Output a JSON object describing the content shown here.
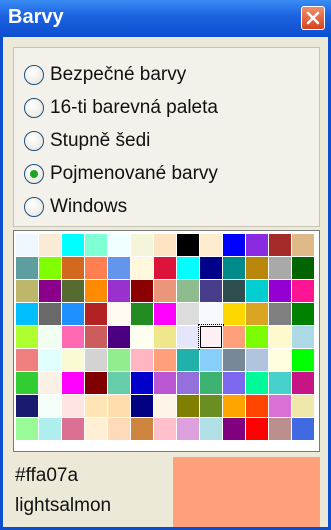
{
  "window": {
    "title": "Barvy",
    "close_icon": "close-icon"
  },
  "options": [
    {
      "label": "Bezpečné barvy",
      "checked": false
    },
    {
      "label": "16-ti barevná paleta",
      "checked": false
    },
    {
      "label": "Stupně šedi",
      "checked": false
    },
    {
      "label": "Pojmenované barvy",
      "checked": true
    },
    {
      "label": "Windows",
      "checked": false
    }
  ],
  "palette": {
    "selected_index": 60,
    "colors": [
      "#f0f8ff",
      "#faebd7",
      "#00ffff",
      "#7fffd4",
      "#f0ffff",
      "#f5f5dc",
      "#ffe4c4",
      "#000000",
      "#ffebcd",
      "#0000ff",
      "#8a2be2",
      "#a52a2a",
      "#deb887",
      "#5f9ea0",
      "#7fff00",
      "#d2691e",
      "#ff7f50",
      "#6495ed",
      "#fff8dc",
      "#dc143c",
      "#00ffff",
      "#00008b",
      "#008b8b",
      "#b8860b",
      "#a9a9a9",
      "#006400",
      "#bdb76b",
      "#8b008b",
      "#556b2f",
      "#ff8c00",
      "#9932cc",
      "#8b0000",
      "#e9967a",
      "#8fbc8f",
      "#483d8b",
      "#2f4f4f",
      "#00ced1",
      "#9400d3",
      "#ff1493",
      "#00bfff",
      "#696969",
      "#1e90ff",
      "#b22222",
      "#fffaf0",
      "#228b22",
      "#ff00ff",
      "#dcdcdc",
      "#f8f8ff",
      "#ffd700",
      "#daa520",
      "#808080",
      "#008000",
      "#adff2f",
      "#f0fff0",
      "#ff69b4",
      "#cd5c5c",
      "#4b0082",
      "#fffff0",
      "#f0e68c",
      "#e6e6fa",
      "#fff0f5",
      "#ffa07a",
      "#7cfc00",
      "#fffacd",
      "#add8e6",
      "#f08080",
      "#e0ffff",
      "#fafad2",
      "#d3d3d3",
      "#90ee90",
      "#ffb6c1",
      "#ffa07a",
      "#20b2aa",
      "#87cefa",
      "#778899",
      "#b0c4de",
      "#ffffe0",
      "#00ff00",
      "#32cd32",
      "#faf0e6",
      "#ff00ff",
      "#800000",
      "#66cdaa",
      "#0000cd",
      "#ba55d3",
      "#9370db",
      "#3cb371",
      "#7b68ee",
      "#00fa9a",
      "#48d1cc",
      "#c71585",
      "#191970",
      "#f5fffa",
      "#ffe4e1",
      "#ffe4b5",
      "#ffdead",
      "#000080",
      "#fdf5e6",
      "#808000",
      "#6b8e23",
      "#ffa500",
      "#ff4500",
      "#da70d6",
      "#eee8aa",
      "#98fb98",
      "#afeeee",
      "#db7093",
      "#ffefd5",
      "#ffdab9",
      "#cd853f",
      "#ffc0cb",
      "#dda0dd",
      "#b0e0e6",
      "#800080",
      "#ff0000",
      "#bc8f8f",
      "#4169e1",
      "#8b4513",
      "#fa8072",
      "#f4a460",
      "#2e8b57",
      "#fff5ee",
      "#a0522d",
      "#c0c0c0",
      "#87ceeb",
      "#6a5acd",
      "#708090",
      "#fffafa",
      "#00ff7f",
      "#4682b4",
      "#d2b48c",
      "#008080",
      "#d8bfd8",
      "#ff6347",
      "#40e0d0",
      "#ee82ee",
      "#f5deb3",
      "#ffffff",
      "#f5f5f5",
      "#ffff00",
      "#9acd32",
      "#e0e0e0"
    ]
  },
  "selected": {
    "hex": "#ffa07a",
    "name": "lightsalmon",
    "swatch_color": "#ffa07a"
  }
}
